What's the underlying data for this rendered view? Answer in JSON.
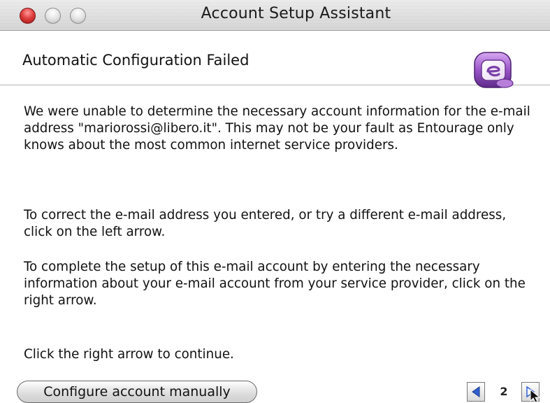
{
  "window": {
    "title": "Account Setup Assistant"
  },
  "header": {
    "title": "Automatic Configuration Failed",
    "icon": "entourage-app-icon"
  },
  "content": {
    "paragraph_1": "We were unable to determine the necessary account information for the e-mail address \"mariorossi@libero.it\". This may not be your fault as Entourage only knows about the most common internet service providers.",
    "paragraph_2": "To correct the e-mail address you entered, or try a different e-mail address, click on the left arrow.",
    "paragraph_3": "To complete the setup of this e-mail account by entering the necessary information about your e-mail account from your service provider, click on the right arrow.",
    "paragraph_4": "Click the right arrow to continue."
  },
  "footer": {
    "configure_button_label": "Configure account manually",
    "page_number": "2",
    "prev_icon": "left-arrow-icon",
    "next_icon": "right-arrow-icon"
  },
  "colors": {
    "close_button": "#e0403f",
    "arrow_blue": "#2f5fd0",
    "icon_purple": "#8a4bb8"
  }
}
